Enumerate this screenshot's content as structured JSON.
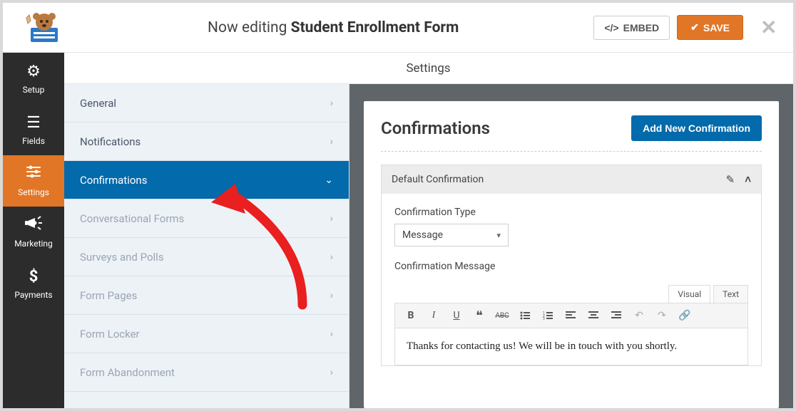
{
  "topbar": {
    "editing_prefix": "Now editing ",
    "form_name": "Student Enrollment Form",
    "embed_label": "EMBED",
    "save_label": "SAVE"
  },
  "sidebar": {
    "items": [
      {
        "label": "Setup",
        "icon": "gear"
      },
      {
        "label": "Fields",
        "icon": "list"
      },
      {
        "label": "Settings",
        "icon": "sliders",
        "active": true
      },
      {
        "label": "Marketing",
        "icon": "bullhorn"
      },
      {
        "label": "Payments",
        "icon": "dollar"
      }
    ]
  },
  "settings_title": "Settings",
  "settings_menu": [
    {
      "label": "General",
      "state": "normal"
    },
    {
      "label": "Notifications",
      "state": "normal"
    },
    {
      "label": "Confirmations",
      "state": "active"
    },
    {
      "label": "Conversational Forms",
      "state": "muted"
    },
    {
      "label": "Surveys and Polls",
      "state": "muted"
    },
    {
      "label": "Form Pages",
      "state": "muted"
    },
    {
      "label": "Form Locker",
      "state": "muted"
    },
    {
      "label": "Form Abandonment",
      "state": "muted"
    }
  ],
  "panel": {
    "title": "Confirmations",
    "add_btn": "Add New Confirmation",
    "block_title": "Default Confirmation",
    "type_label": "Confirmation Type",
    "type_value": "Message",
    "msg_label": "Confirmation Message",
    "tabs": {
      "visual": "Visual",
      "text": "Text"
    },
    "message": "Thanks for contacting us! We will be in touch with you shortly."
  }
}
